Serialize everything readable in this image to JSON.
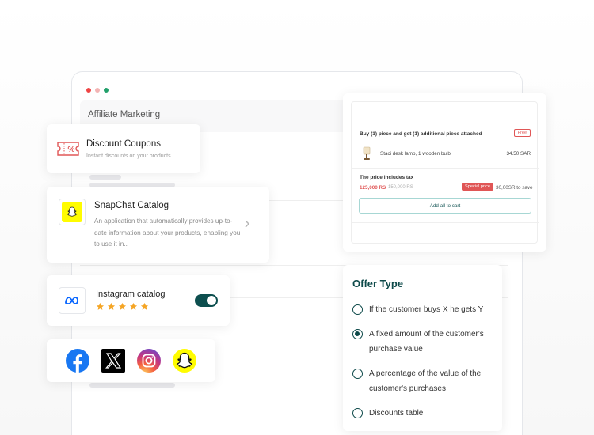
{
  "window": {
    "title": "Affiliate Marketing",
    "dot_colors": [
      "#ef4444",
      "#f3b4b4",
      "#22a06b"
    ]
  },
  "coupons": {
    "title": "Discount Coupons",
    "subtitle": "Instant discounts on your products",
    "icon": "coupon-percent-icon",
    "accent": "#e05656"
  },
  "snapchat": {
    "title": "SnapChat Catalog",
    "description": "An application that automatically provides up-to-date information about your products, enabling you to use it in..",
    "icon": "snapchat-ghost-icon",
    "accent": "#fffc00"
  },
  "instagram": {
    "title": "Instagram catalog",
    "icon": "meta-logo-icon",
    "rating": 5,
    "toggle_on": true,
    "star_color": "#f5a524"
  },
  "social": {
    "icons": [
      "facebook-icon",
      "x-icon",
      "instagram-icon",
      "snapchat-icon"
    ]
  },
  "offer_card": {
    "offer_text": "Buy (1) piece and get (1) additional piece attached",
    "badge": "Free",
    "product_name": "Staci desk lamp, 1 wooden bulb",
    "product_price": "34.50 SAR",
    "tax_note": "The price includes tax",
    "price": "125,000 RS",
    "old_price": "150,000 RS",
    "special_label": "Special price",
    "save_text": "30,00SR to save",
    "cart_button": "Add all to cart"
  },
  "offer_type": {
    "title": "Offer Type",
    "options": [
      {
        "label": "If the customer buys X he gets Y",
        "selected": false
      },
      {
        "label": "A fixed amount of the customer's purchase value",
        "selected": true
      },
      {
        "label": "A percentage of the value of the customer's purchases",
        "selected": false
      },
      {
        "label": "Discounts table",
        "selected": false
      }
    ],
    "accent": "#0e4a4a"
  }
}
